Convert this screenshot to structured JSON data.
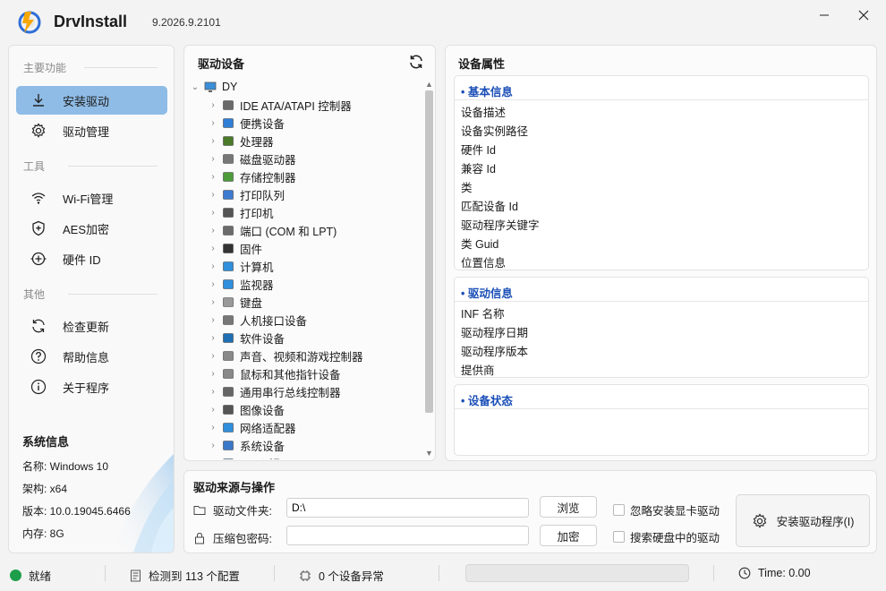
{
  "app": {
    "name": "DrvInstall",
    "version": "9.2026.9.2101"
  },
  "sidebar": {
    "section_main": "主要功能",
    "section_tools": "工具",
    "section_other": "其他",
    "items": [
      {
        "label": "安装驱动",
        "icon": "download-icon"
      },
      {
        "label": "驱动管理",
        "icon": "gear-icon"
      },
      {
        "label": "Wi-Fi管理",
        "icon": "wifi-icon"
      },
      {
        "label": "AES加密",
        "icon": "shield-icon"
      },
      {
        "label": "硬件 ID",
        "icon": "chip-plus-icon"
      },
      {
        "label": "检查更新",
        "icon": "refresh-icon"
      },
      {
        "label": "帮助信息",
        "icon": "question-icon"
      },
      {
        "label": "关于程序",
        "icon": "info-icon"
      }
    ],
    "active_index": 0
  },
  "system_info": {
    "title": "系统信息",
    "rows": [
      "名称: Windows 10",
      "架构: x64",
      "版本: 10.0.19045.6466",
      "内存: 8G"
    ]
  },
  "tree": {
    "title": "驱动设备",
    "root": "DY",
    "items": [
      {
        "label": "IDE ATA/ATAPI 控制器",
        "icon": "ide-controller-icon"
      },
      {
        "label": "便携设备",
        "icon": "portable-device-icon"
      },
      {
        "label": "处理器",
        "icon": "processor-icon"
      },
      {
        "label": "磁盘驱动器",
        "icon": "disk-drive-icon"
      },
      {
        "label": "存储控制器",
        "icon": "storage-controller-icon"
      },
      {
        "label": "打印队列",
        "icon": "print-queue-icon"
      },
      {
        "label": "打印机",
        "icon": "printer-icon"
      },
      {
        "label": "端口 (COM 和 LPT)",
        "icon": "port-icon"
      },
      {
        "label": "固件",
        "icon": "firmware-icon"
      },
      {
        "label": "计算机",
        "icon": "computer-icon"
      },
      {
        "label": "监视器",
        "icon": "monitor-icon"
      },
      {
        "label": "键盘",
        "icon": "keyboard-icon"
      },
      {
        "label": "人机接口设备",
        "icon": "hid-icon"
      },
      {
        "label": "软件设备",
        "icon": "software-device-icon"
      },
      {
        "label": "声音、视频和游戏控制器",
        "icon": "speaker-icon"
      },
      {
        "label": "鼠标和其他指针设备",
        "icon": "mouse-icon"
      },
      {
        "label": "通用串行总线控制器",
        "icon": "usb-icon"
      },
      {
        "label": "图像设备",
        "icon": "camera-icon"
      },
      {
        "label": "网络适配器",
        "icon": "network-adapter-icon"
      },
      {
        "label": "系统设备",
        "icon": "system-device-icon"
      },
      {
        "label": "显示适配器",
        "icon": "display-adapter-icon"
      }
    ]
  },
  "properties": {
    "title": "设备属性",
    "groups": [
      {
        "title": "• 基本信息",
        "rows": [
          "设备描述",
          "设备实例路径",
          "硬件 Id",
          "兼容 Id",
          "类",
          "匹配设备 Id",
          "驱动程序关键字",
          "类 Guid",
          "位置信息"
        ]
      },
      {
        "title": "• 驱动信息",
        "rows": [
          "INF 名称",
          "驱动程序日期",
          "驱动程序版本",
          "提供商"
        ]
      },
      {
        "title": "• 设备状态",
        "rows": []
      }
    ]
  },
  "operations": {
    "title": "驱动来源与操作",
    "folder_label": "驱动文件夹:",
    "folder_value": "D:\\",
    "password_label": "压缩包密码:",
    "password_value": "",
    "browse_button": "浏览",
    "encrypt_button": "加密",
    "check_ignore_gpu": "忽略安装显卡驱动",
    "check_search_disk": "搜索硬盘中的驱动",
    "install_button": "安装驱动程序(I)"
  },
  "status": {
    "state": "就绪",
    "configs": "检测到 113 个配置",
    "abnormal": "0 个设备异常",
    "time": "Time: 0.00",
    "progress": 0
  },
  "colors": {
    "accent": "#8fbce6",
    "group_title": "#1b4fb7",
    "status_ok": "#1e9e4a"
  }
}
